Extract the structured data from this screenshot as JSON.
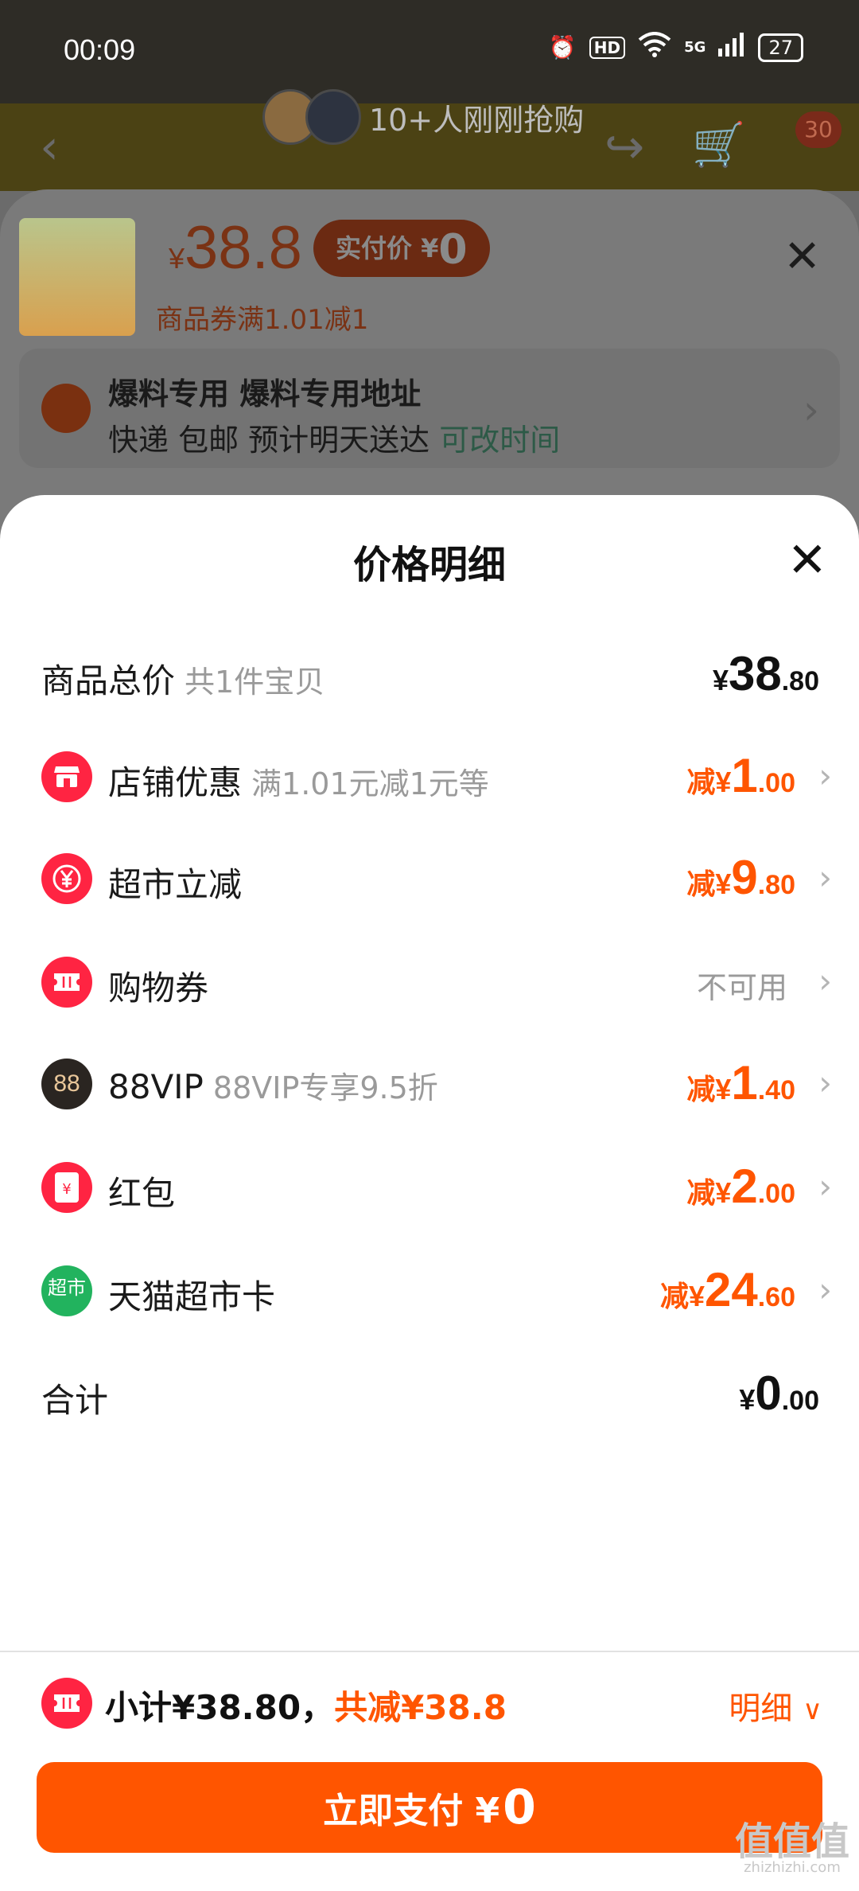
{
  "status_bar": {
    "time": "00:09",
    "hd": "HD",
    "network": "5G",
    "battery": "27"
  },
  "background": {
    "live_text": "10+人刚刚抢购",
    "cart_count": "30"
  },
  "product": {
    "currency": "¥",
    "price": "38.8",
    "pay_label": "实付价 ¥",
    "pay_amount": "0",
    "coupon_note": "商品券满1.01减1"
  },
  "address": {
    "title": "爆料专用 爆料专用地址",
    "delivery": "快递 包邮 预计明天送达",
    "change_time": "可改时间"
  },
  "panel": {
    "title": "价格明细",
    "total_label": "商品总价",
    "total_hint": "共1件宝贝",
    "total_amount": {
      "pre": "¥",
      "int": "38",
      "dec": ".80"
    },
    "rows": [
      {
        "label": "店铺优惠",
        "hint": "满1.01元减1元等",
        "pre": "减¥",
        "int": "1",
        "dec": ".00",
        "icon_color": "#ff2442"
      },
      {
        "label": "超市立减",
        "hint": "",
        "pre": "减¥",
        "int": "9",
        "dec": ".80",
        "icon_color": "#ff2442"
      },
      {
        "label": "购物券",
        "hint": "",
        "status": "不可用",
        "icon_color": "#ff2442"
      },
      {
        "label": "88VIP",
        "hint": "88VIP专享9.5折",
        "pre": "减¥",
        "int": "1",
        "dec": ".40",
        "icon_color": "#2a2521",
        "icon_text": "88"
      },
      {
        "label": "红包",
        "hint": "",
        "pre": "减¥",
        "int": "2",
        "dec": ".00",
        "icon_color": "#ff2442",
        "icon_text": "¥"
      },
      {
        "label": "天猫超市卡",
        "hint": "",
        "pre": "减¥",
        "int": "24",
        "dec": ".60",
        "icon_color": "#22b35e",
        "icon_text": "超市"
      }
    ],
    "sum_label": "合计",
    "sum_amount": {
      "pre": "¥",
      "int": "0",
      "dec": ".00"
    }
  },
  "bottom": {
    "subtotal": "小计¥38.80，",
    "saved": "共减¥38.8",
    "detail": "明细",
    "pay_button": "立即支付 ¥",
    "pay_amount": "0"
  },
  "watermark": {
    "text": "值值值",
    "url": "zhizhizhi.com"
  },
  "colors": {
    "accent": "#ff5500",
    "red": "#ff2442",
    "green_change": "#1a9b6c"
  }
}
